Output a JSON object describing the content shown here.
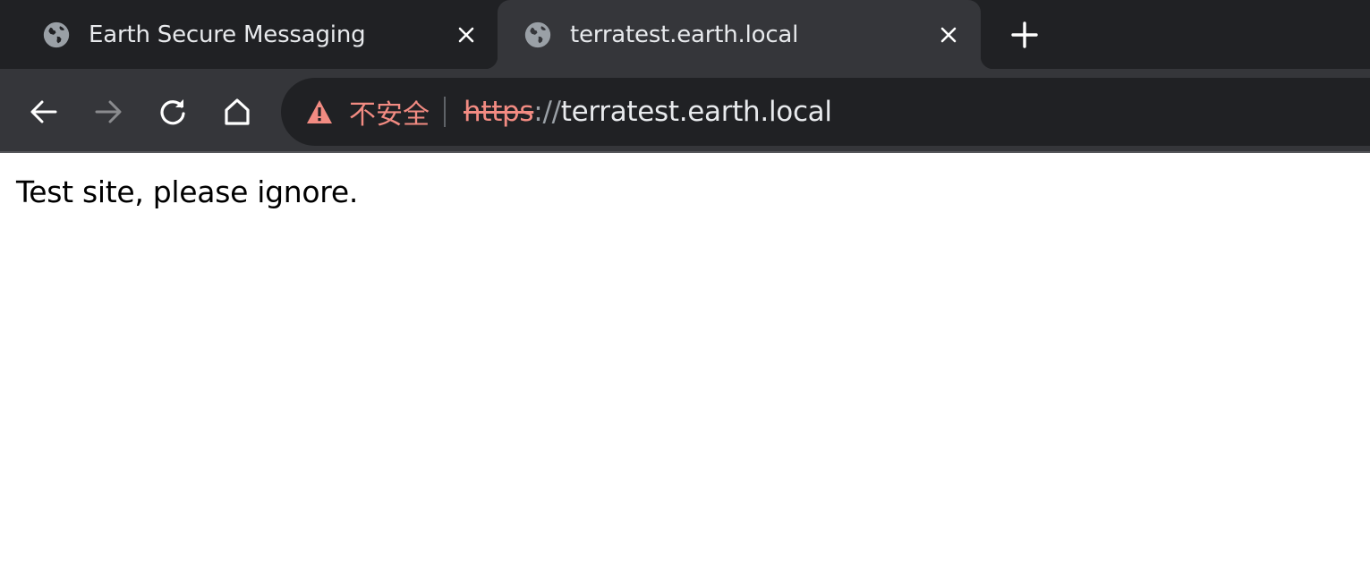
{
  "tabs": [
    {
      "title": "Earth Secure Messaging",
      "favicon": "globe-icon",
      "active": false
    },
    {
      "title": "terratest.earth.local",
      "favicon": "globe-icon",
      "active": true
    }
  ],
  "toolbar": {
    "back_icon": "arrow-left-icon",
    "forward_icon": "arrow-right-icon",
    "reload_icon": "reload-icon",
    "home_icon": "home-icon",
    "new_tab_icon": "plus-icon"
  },
  "omnibox": {
    "security_icon": "warning-triangle-icon",
    "security_label": "不安全",
    "url_scheme": "https",
    "url_separator": "://",
    "url_host": "terratest.earth.local"
  },
  "page": {
    "body_text": "Test site, please ignore."
  },
  "colors": {
    "tabstrip_bg": "#202124",
    "active_tab_bg": "#35363a",
    "omnibox_bg": "#202124",
    "text_light": "#e8eaed",
    "warning_red": "#f28b82",
    "muted_gray": "#9aa0a6"
  }
}
